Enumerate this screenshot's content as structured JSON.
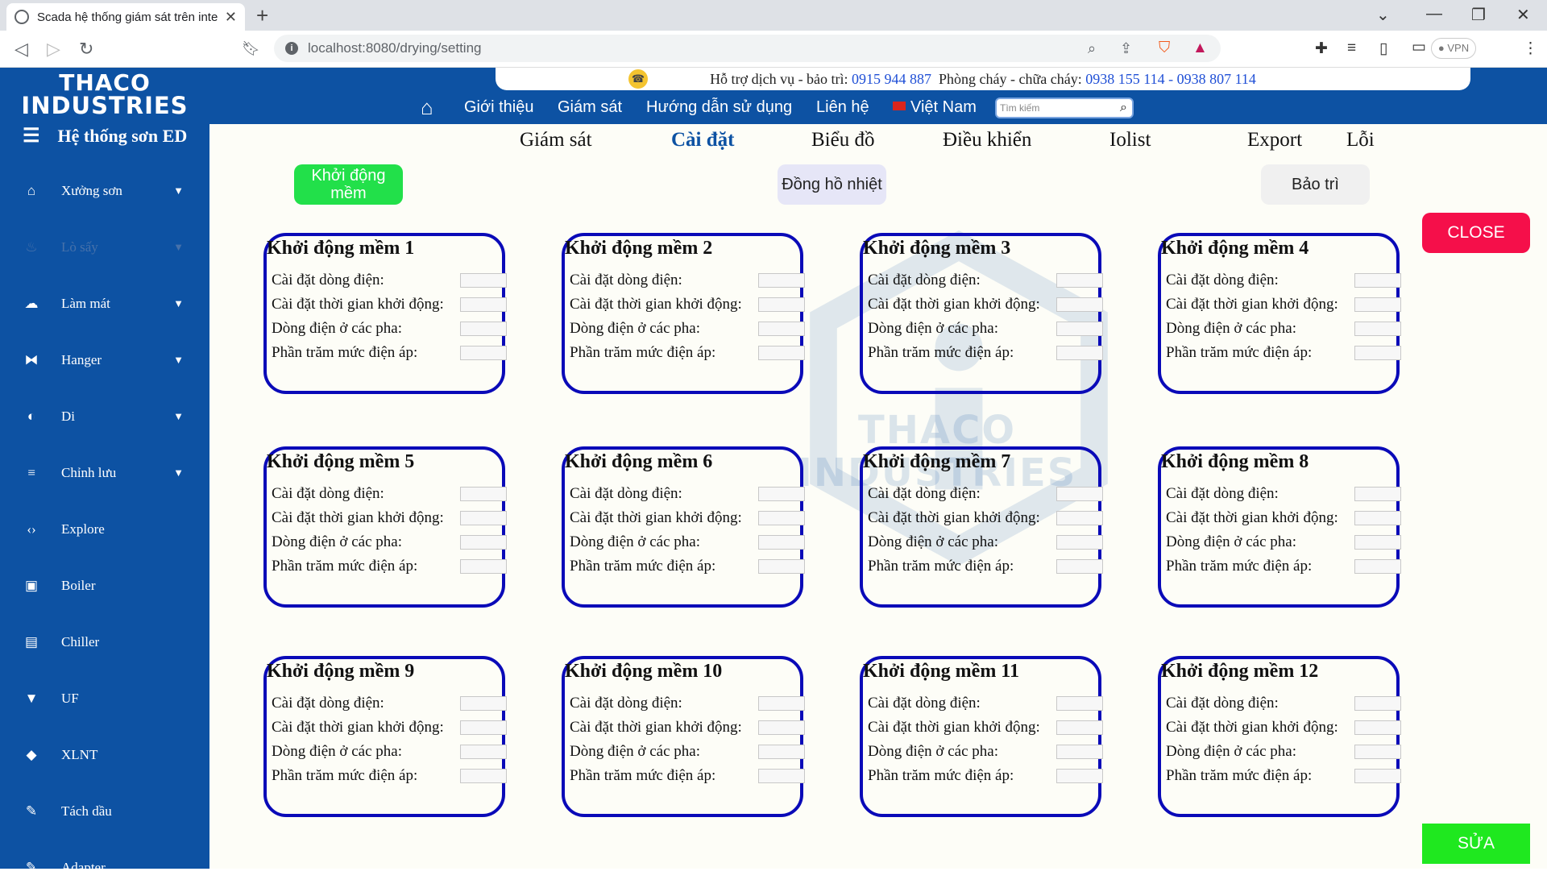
{
  "browser": {
    "tab_title": "Scada hệ thống giám sát trên inte",
    "url": "localhost:8080/drying/setting",
    "vpn_label": "VPN"
  },
  "brand": {
    "logo_line1": "THACO",
    "logo_line2": "INDUSTRIES",
    "system_title": "Hệ thống sơn ED"
  },
  "hotline": {
    "support_label": "Hỗ trợ dịch vụ - bảo trì:",
    "support_number": "0915 944 887",
    "fire_label": "Phòng cháy - chữa cháy:",
    "fire_numbers": "0938 155 114 - 0938 807 114"
  },
  "mainnav": {
    "items": [
      "Giới thiệu",
      "Giám sát",
      "Hướng dẫn sử dụng",
      "Liên hệ"
    ],
    "language": "Việt Nam",
    "search_placeholder": "Tìm kiếm"
  },
  "sidebar": {
    "items": [
      {
        "label": "Xưởng sơn",
        "icon": "home-icon",
        "has_chevron": true
      },
      {
        "label": "Lò sấy",
        "icon": "flame-icon",
        "has_chevron": true
      },
      {
        "label": "Làm mát",
        "icon": "cloud-icon",
        "has_chevron": true
      },
      {
        "label": "Hanger",
        "icon": "hanger-icon",
        "has_chevron": true
      },
      {
        "label": "Di",
        "icon": "drop-icon",
        "has_chevron": true
      },
      {
        "label": "Chỉnh lưu",
        "icon": "database-icon",
        "has_chevron": true
      },
      {
        "label": "Explore",
        "icon": "code-icon",
        "has_chevron": false
      },
      {
        "label": "Boiler",
        "icon": "boiler-icon",
        "has_chevron": false
      },
      {
        "label": "Chiller",
        "icon": "chiller-icon",
        "has_chevron": false
      },
      {
        "label": "UF",
        "icon": "filter-icon",
        "has_chevron": false
      },
      {
        "label": "XLNT",
        "icon": "bucket-icon",
        "has_chevron": false
      },
      {
        "label": "Tách dầu",
        "icon": "pen-icon",
        "has_chevron": false
      },
      {
        "label": "Adapter",
        "icon": "pen-icon",
        "has_chevron": false
      }
    ]
  },
  "subtabs": [
    "Giám sát",
    "Cài đặt",
    "Biểu đồ",
    "Điều khiển",
    "Iolist",
    "Export",
    "Lỗi"
  ],
  "active_subtab": "Cài đặt",
  "buttons": {
    "soft_start": "Khởi động mềm",
    "thermometer": "Đồng hồ nhiệt",
    "maintenance": "Bảo trì",
    "close": "CLOSE",
    "edit": "SỬA"
  },
  "field_labels": [
    "Cài đặt dòng điện:",
    "Cài đặt thời gian khởi động:",
    "Dòng điện ở các pha:",
    "Phần trăm mức điện áp:"
  ],
  "cards": [
    "Khởi động mềm 1",
    "Khởi động mềm 2",
    "Khởi động mềm 3",
    "Khởi động mềm 4",
    "Khởi động mềm 5",
    "Khởi động mềm 6",
    "Khởi động mềm 7",
    "Khởi động mềm 8",
    "Khởi động mềm 9",
    "Khởi động mềm 10",
    "Khởi động mềm 11",
    "Khởi động mềm 12"
  ],
  "watermark": {
    "line1": "THACO",
    "line2": "INDUSTRIES"
  },
  "colors": {
    "brand_blue": "#0d52a3",
    "card_border": "#0a0ab8",
    "close": "#f50f4a",
    "edit": "#1fe81f",
    "soft_start": "#22e04a"
  }
}
